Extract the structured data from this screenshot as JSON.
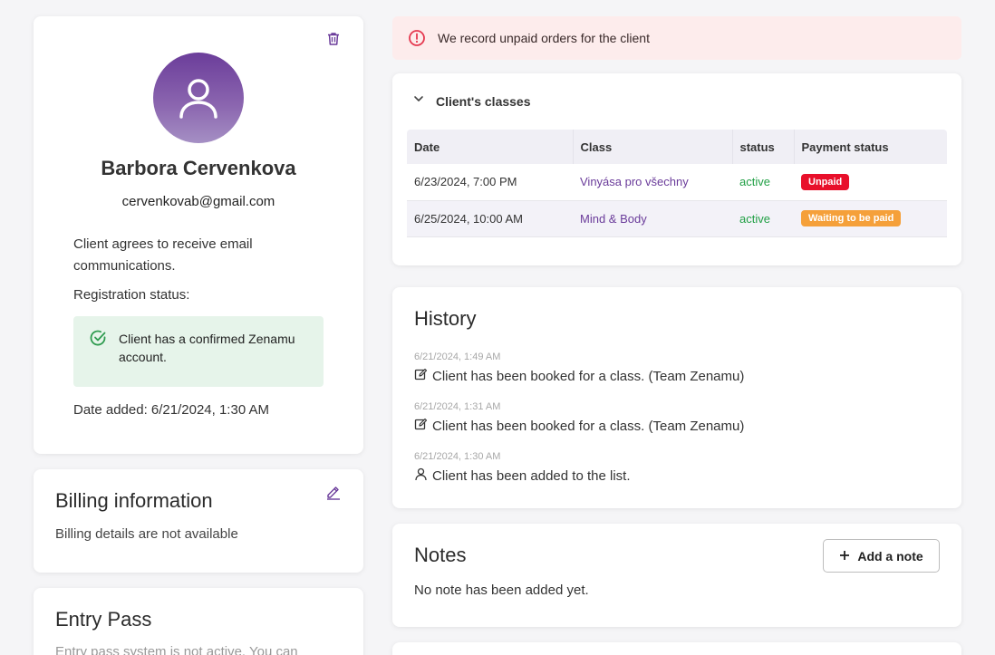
{
  "alert": {
    "text": "We record unpaid orders for the client",
    "icon": "alert-circle-icon",
    "color": "#e53950"
  },
  "profile": {
    "name": "Barbora Cervenkova",
    "email": "cervenkovab@gmail.com",
    "consent": "Client agrees to receive email communications.",
    "registration_label": "Registration status:",
    "confirmed_text": "Client has a confirmed Zenamu account.",
    "date_added": "Date added: 6/21/2024, 1:30 AM",
    "accent": "#6b3d9a"
  },
  "billing": {
    "title": "Billing information",
    "text": "Billing details are not available"
  },
  "entry_pass": {
    "title": "Entry Pass",
    "text": "Entry pass system is not active. You can"
  },
  "classes": {
    "title": "Client's classes",
    "columns": [
      "Date",
      "Class",
      "status",
      "Payment status"
    ],
    "rows": [
      {
        "date": "6/23/2024, 7:00 PM",
        "class": "Vinyása pro všechny",
        "status": "active",
        "payment": "Unpaid"
      },
      {
        "date": "6/25/2024, 10:00 AM",
        "class": "Mind & Body",
        "status": "active",
        "payment": "Waiting to be paid"
      }
    ],
    "status_color": "#22a046",
    "unpaid_color": "#e8102b",
    "waiting_color": "#f5a03a"
  },
  "history": {
    "title": "History",
    "items": [
      {
        "time": "6/21/2024, 1:49 AM",
        "text": "Client has been booked for a class. (Team Zenamu)",
        "icon": "edit-icon"
      },
      {
        "time": "6/21/2024, 1:31 AM",
        "text": "Client has been booked for a class. (Team Zenamu)",
        "icon": "edit-icon"
      },
      {
        "time": "6/21/2024, 1:30 AM",
        "text": "Client has been added to the list.",
        "icon": "user-icon"
      }
    ]
  },
  "notes": {
    "title": "Notes",
    "add_label": "Add a note",
    "empty_text": "No note has been added yet."
  }
}
